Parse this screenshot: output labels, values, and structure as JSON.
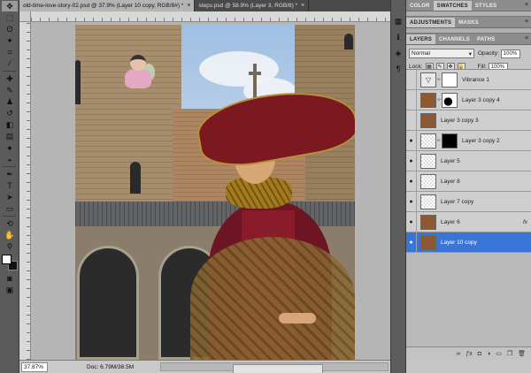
{
  "tabs": [
    {
      "label": "old-time-love-story-02.psd @ 37.9% (Layer 10 copy, RGB/8#) *",
      "close": "×"
    },
    {
      "label": "steps.psd @ 58.9% (Layer 3, RGB/8) *",
      "close": "×"
    }
  ],
  "status": {
    "zoom": "37.87%",
    "doc": "Doc: 6.79M/38.5M"
  },
  "color_panel": {
    "tabs": [
      "COLOR",
      "SWATCHES",
      "STYLES"
    ],
    "active": "SWATCHES"
  },
  "adjustments_panel": {
    "tabs": [
      "ADJUSTMENTS",
      "MASKS"
    ]
  },
  "layers_panel": {
    "tabs": [
      "LAYERS",
      "CHANNELS",
      "PATHS"
    ],
    "blend_mode": "Normal",
    "opacity_label": "Opacity:",
    "opacity_value": "100%",
    "fill_label": "Fill:",
    "fill_value": "100%",
    "lock_label": "Lock:",
    "layers": [
      {
        "name": "Vibrance 1",
        "visible": false
      },
      {
        "name": "Layer 3 copy 4",
        "visible": false
      },
      {
        "name": "Layer 3 copy 3",
        "visible": false
      },
      {
        "name": "Layer 3 copy 2",
        "visible": true
      },
      {
        "name": "Layer 5",
        "visible": true
      },
      {
        "name": "Layer 8",
        "visible": true
      },
      {
        "name": "Layer 7 copy",
        "visible": true
      },
      {
        "name": "Layer 6",
        "visible": true,
        "fx": "fx"
      },
      {
        "name": "Layer 10 copy",
        "visible": true,
        "selected": true
      }
    ]
  },
  "accent_color": "#3875d7"
}
